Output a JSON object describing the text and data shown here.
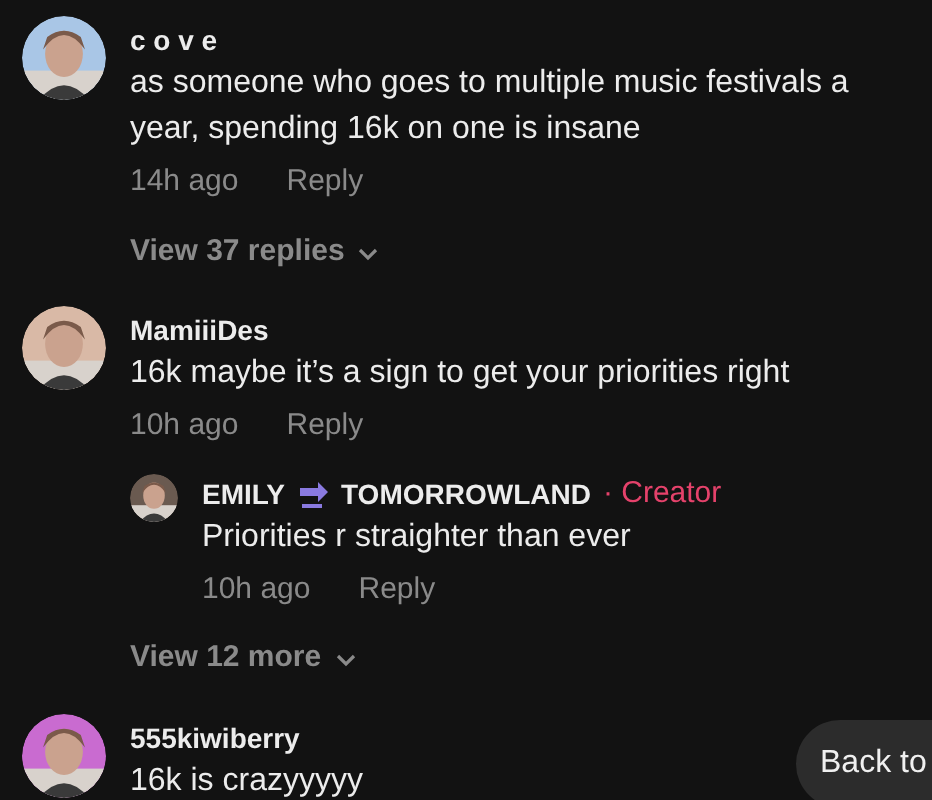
{
  "comments": [
    {
      "kind": "comment",
      "user": "c o v e",
      "text": "as someone who goes to multiple music festivals a year, spending 16k on one is insane",
      "time": "14h ago",
      "reply": "Reply",
      "view_more": "View 37 replies"
    },
    {
      "kind": "comment",
      "user": "MamiiiDes",
      "text": "16k maybe it’s a sign to get your priorities right",
      "time": "10h ago",
      "reply": "Reply",
      "replies": [
        {
          "user_first": "EMILY",
          "user_second": "TOMORROWLAND",
          "badge": "· Creator",
          "text": "Priorities r straighter than ever",
          "time": "10h ago",
          "reply": "Reply"
        }
      ],
      "view_more": "View 12 more"
    },
    {
      "kind": "comment",
      "user": "555kiwiberry",
      "text": "16k is crazyyyyy"
    }
  ],
  "back_button": "Back to"
}
